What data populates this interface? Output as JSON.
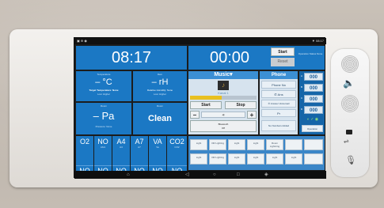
{
  "status_bar": {
    "left_icons": "▣ ⊕ ◉",
    "right_icons": "▼ 08:17"
  },
  "clock": {
    "time": "08:17"
  },
  "timer": {
    "time": "00:00",
    "start_label": "Start",
    "reset_label": "Reset",
    "info_label": "Operation Status None"
  },
  "temperature": {
    "label": "Temperature",
    "sublabel": "Now",
    "value": "– °C",
    "target": "Target Temperature: None",
    "range": "Low: Higher"
  },
  "humidity": {
    "label": "Rem",
    "value": "– rH",
    "target": "Relative Humidity: None",
    "range": "Low: Higher"
  },
  "pressure": {
    "label": "Room",
    "value": "– Pa",
    "sub": "Pressure: None"
  },
  "cleanliness": {
    "label": "Room",
    "value": "Clean"
  },
  "music": {
    "title": "Music",
    "track": "Kanal 1",
    "start_label": "Start",
    "stop_label": "Stop",
    "minus_label": "–",
    "plus_label": "+",
    "source_label": "Bluetooth",
    "sub_label": "Off"
  },
  "phone": {
    "title": "Phone",
    "phone_no_label": "Phone No",
    "call_label": "Ans",
    "answer_label": "Answer Voicemail",
    "contact_label": "Pr",
    "no_number_label": "No Numbers Added"
  },
  "indicators": [
    {
      "value": "000",
      "label": "A"
    },
    {
      "value": "000",
      "label": "B"
    },
    {
      "value": "000",
      "label": "C"
    },
    {
      "value": "000",
      "label": "D"
    }
  ],
  "extra_controls": {
    "status_icons": "◐ ✓ ◉",
    "label": "Operation"
  },
  "gases": [
    {
      "code": "O2",
      "sub": "",
      "value": "NO"
    },
    {
      "code": "NO",
      "sub": "Abnt",
      "value": "NO"
    },
    {
      "code": "A4",
      "sub": "A4",
      "value": "NO"
    },
    {
      "code": "A7",
      "sub": "A7",
      "value": "NO"
    },
    {
      "code": "VA",
      "sub": "Va",
      "value": "NO"
    },
    {
      "code": "CO2",
      "sub": "CO2",
      "value": "NO"
    }
  ],
  "bottom_buttons": [
    "Light",
    "OR Lighting",
    "Light",
    "Light",
    "Room Lightning",
    "",
    "",
    "Light",
    "OR Lighting",
    "Light",
    "Light",
    "Light",
    "Light",
    ""
  ],
  "nav": {
    "back": "◁",
    "home": "○",
    "recent": "□",
    "extra1": "⌂",
    "extra2": "◈"
  }
}
